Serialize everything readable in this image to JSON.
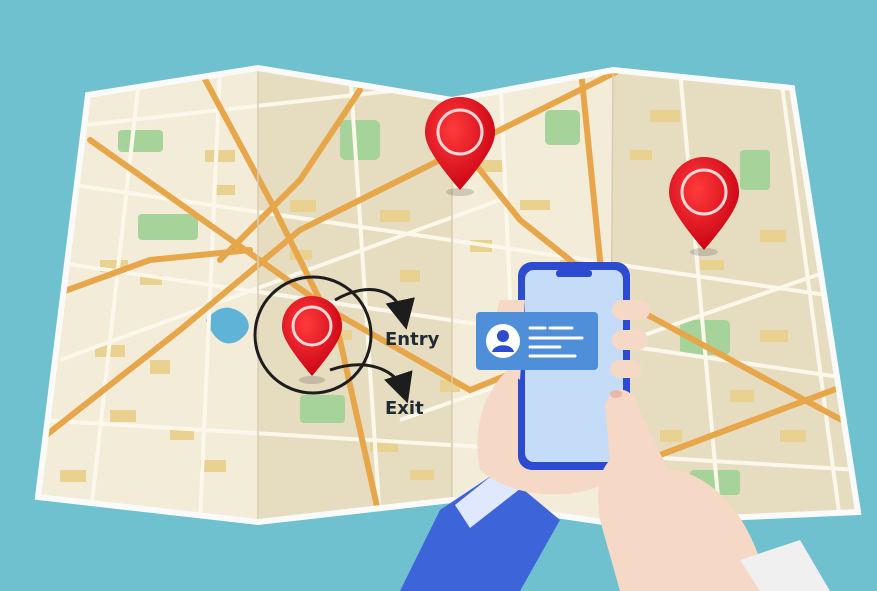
{
  "scene": {
    "labels": {
      "entry": "Entry",
      "exit": "Exit"
    },
    "colors": {
      "background": "#6fc1cf",
      "map_paper": "#f2ead4",
      "map_fold_shadow": "#e3d9bd",
      "major_road": "#e8a64a",
      "minor_road": "#f7f3e6",
      "building": "#e9d28f",
      "park": "#a6d39a",
      "water": "#5fb3d6",
      "pin": "#e2001a",
      "phone_frame": "#2c4bd1",
      "phone_screen": "#c4dcf7",
      "contact_card": "#4f8fd9",
      "sleeve": "#3d64d8",
      "skin": "#f6d8c7",
      "geofence_ring": "#1d1d1d"
    },
    "icons": [
      "location-pin-icon",
      "geofence-circle-icon",
      "arrow-icon",
      "person-icon",
      "smartphone-icon"
    ]
  }
}
